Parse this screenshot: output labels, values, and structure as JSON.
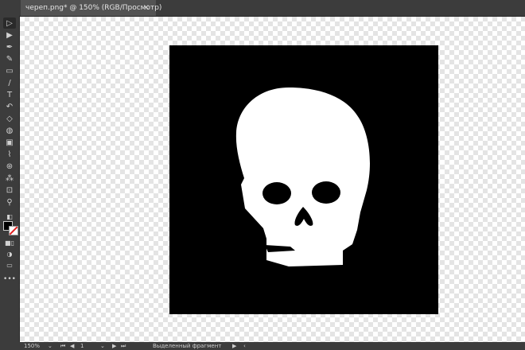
{
  "document_tab": {
    "title": "череп.png* @ 150% (RGB/Просмотр)",
    "close": "×"
  },
  "tools": [
    {
      "name": "selection-tool-icon",
      "glyph": "▷"
    },
    {
      "name": "direct-selection-tool-icon",
      "glyph": "▶"
    },
    {
      "name": "pen-tool-icon",
      "glyph": "✒"
    },
    {
      "name": "curvature-tool-icon",
      "glyph": "✎"
    },
    {
      "name": "rectangle-tool-icon",
      "glyph": "▭"
    },
    {
      "name": "paintbrush-tool-icon",
      "glyph": "/"
    },
    {
      "name": "type-tool-icon",
      "glyph": "T"
    },
    {
      "name": "rotate-tool-icon",
      "glyph": "↶"
    },
    {
      "name": "eraser-tool-icon",
      "glyph": "◇"
    },
    {
      "name": "shape-builder-tool-icon",
      "glyph": "◍"
    },
    {
      "name": "gradient-tool-icon",
      "glyph": "▣"
    },
    {
      "name": "eyedropper-tool-icon",
      "glyph": "⌇"
    },
    {
      "name": "blend-tool-icon",
      "glyph": "⊛"
    },
    {
      "name": "symbol-sprayer-tool-icon",
      "glyph": "⁂"
    },
    {
      "name": "artboard-tool-icon",
      "glyph": "⊡"
    },
    {
      "name": "zoom-tool-icon",
      "glyph": "⚲"
    }
  ],
  "colors": {
    "fill": "#000000",
    "stroke_none_indicator": "#e02020",
    "artboard": "#000000",
    "skull": "#ffffff"
  },
  "statusbar": {
    "zoom": "150%",
    "artboard_number": "1",
    "selection_label": "Выделенный фрагмент"
  }
}
